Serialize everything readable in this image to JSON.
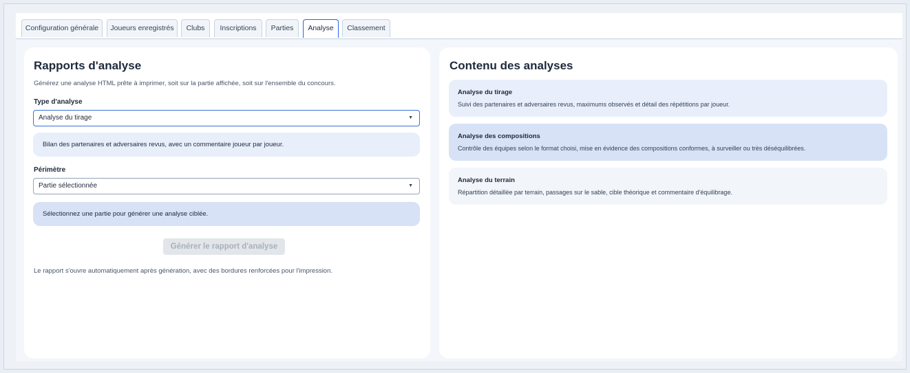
{
  "tabs": [
    {
      "label": "Configuration générale"
    },
    {
      "label": "Joueurs enregistrés"
    },
    {
      "label": "Clubs"
    },
    {
      "label": "Inscriptions"
    },
    {
      "label": "Parties"
    },
    {
      "label": "Analyse",
      "active": true
    },
    {
      "label": "Classement"
    }
  ],
  "left": {
    "title": "Rapports d'analyse",
    "description": "Générez une analyse HTML prête à imprimer, soit sur la partie affichée, soit sur l'ensemble du concours.",
    "type_label": "Type d'analyse",
    "type_value": "Analyse du tirage",
    "type_info": "Bilan des partenaires et adversaires revus, avec un commentaire joueur par joueur.",
    "scope_label": "Périmètre",
    "scope_value": "Partie sélectionnée",
    "scope_info": "Sélectionnez une partie pour générer une analyse ciblée.",
    "generate_button": "Générer le rapport d'analyse",
    "footer_note": "Le rapport s'ouvre automatiquement après génération, avec des bordures renforcées pour l'impression."
  },
  "right": {
    "title": "Contenu des analyses",
    "cards": [
      {
        "title": "Analyse du tirage",
        "text": "Suivi des partenaires et adversaires revus, maximums observés et détail des répétitions par joueur."
      },
      {
        "title": "Analyse des compositions",
        "text": "Contrôle des équipes selon le format choisi, mise en évidence des compositions conformes, à surveiller ou très déséquilibrées."
      },
      {
        "title": "Analyse du terrain",
        "text": "Répartition détaillée par terrain, passages sur le sable, cible théorique et commentaire d'équilibrage."
      }
    ]
  },
  "icons": {
    "select_caret": "chevron-down-icon"
  },
  "colors": {
    "accent": "#2563eb",
    "info_light": "#e8effb",
    "info_strong": "#d7e2f6",
    "disabled_button": "#e2e6ea"
  }
}
